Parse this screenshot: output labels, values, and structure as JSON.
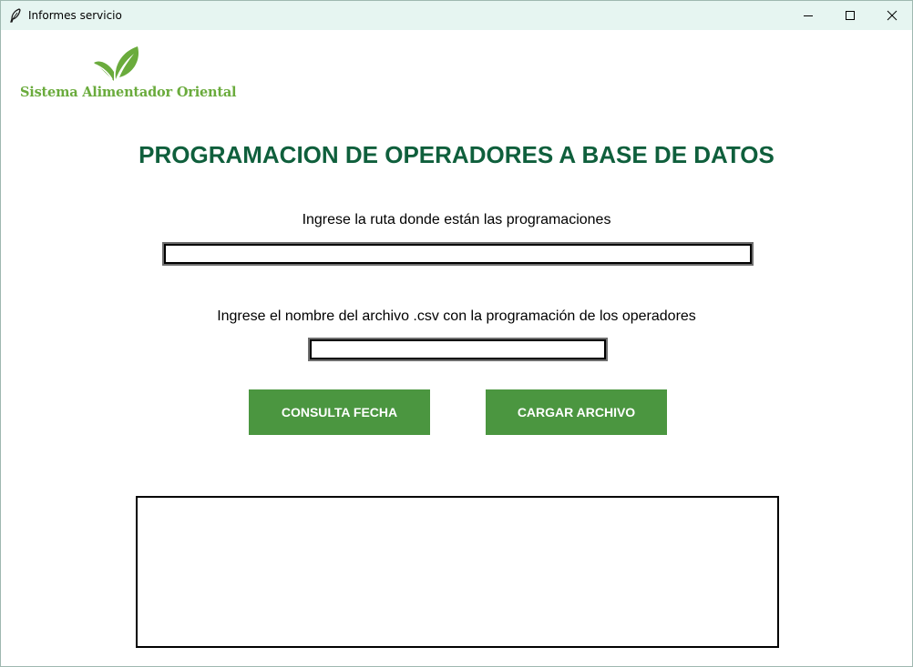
{
  "window": {
    "title": "Informes servicio",
    "icon": "feather-icon",
    "controls": [
      "minimize-icon",
      "maximize-icon",
      "close-icon"
    ]
  },
  "logo": {
    "text": "Sistema Alimentador Oriental",
    "color": "#6aab3c"
  },
  "page": {
    "title": "PROGRAMACION DE OPERADORES A BASE DE DATOS",
    "title_color": "#0f5f3c"
  },
  "form": {
    "path_label": "Ingrese la ruta donde están las programaciones",
    "path_value": "",
    "file_label": "Ingrese el nombre del archivo .csv con la programación de los operadores",
    "file_value": ""
  },
  "buttons": {
    "consulta_label": "CONSULTA FECHA",
    "cargar_label": "CARGAR ARCHIVO",
    "color": "#4b9640"
  },
  "output": {
    "text": ""
  }
}
